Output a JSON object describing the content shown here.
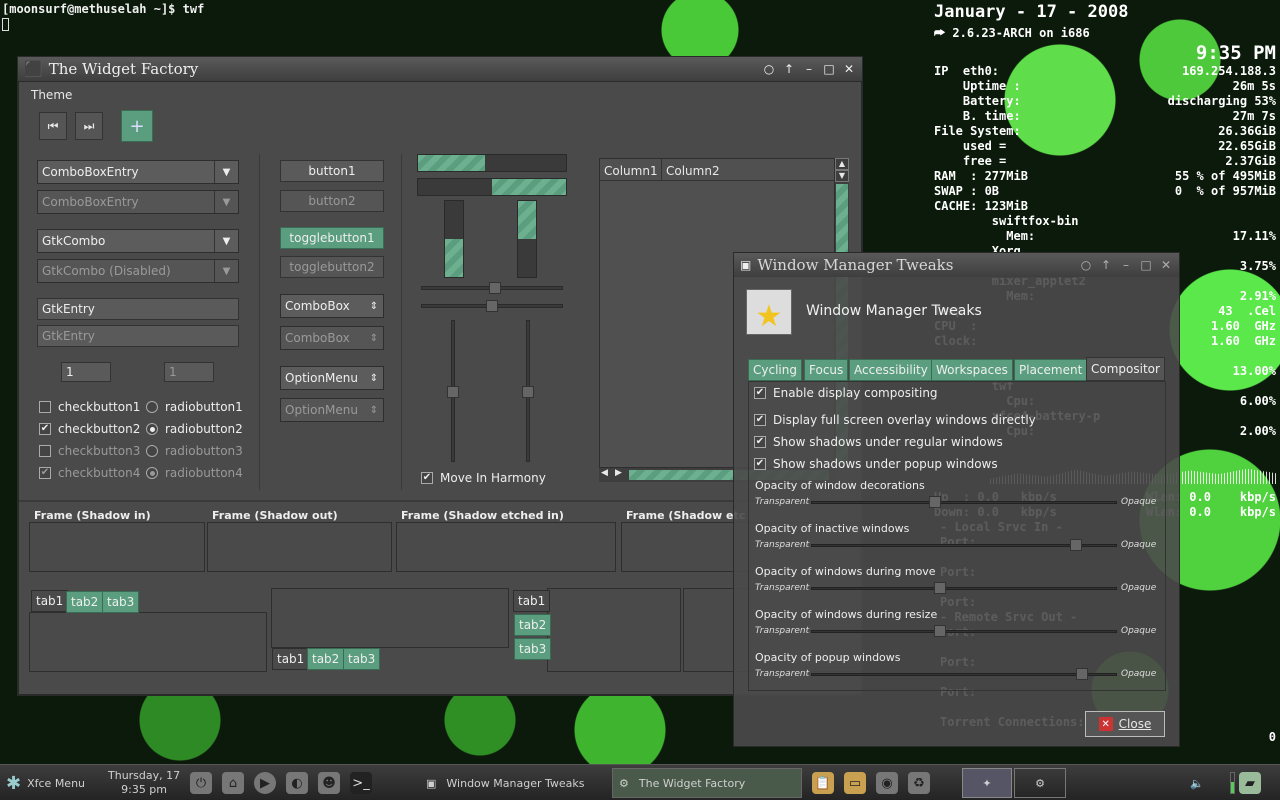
{
  "terminal": {
    "prompt": "[moonsurf@methuselah ~]$ twf"
  },
  "conky": {
    "date": "January - 17 - 2008",
    "kernel": "2.6.23-ARCH on i686",
    "time": "9:35 PM",
    "rows": [
      {
        "l": "IP  eth0:",
        "r": "169.254.188.3"
      },
      {
        "l": "    Uptime :",
        "r": "26m 5s"
      },
      {
        "l": "    Battery:",
        "r": "discharging 53%"
      },
      {
        "l": "    B. time:",
        "r": "27m 7s"
      },
      {
        "l": "File System:",
        "r": "26.36GiB"
      },
      {
        "l": "    used =",
        "r": "22.65GiB"
      },
      {
        "l": "    free =",
        "r": "2.37GiB"
      },
      {
        "l": "RAM  : 277MiB",
        "r": "55 % of 495MiB"
      },
      {
        "l": "SWAP : 0B",
        "r": "0  % of 957MiB"
      },
      {
        "l": "CACHE: 123MiB",
        "r": ""
      },
      {
        "l": "        swiftfox-bin",
        "r": ""
      },
      {
        "l": "          Mem:",
        "r": "17.11%"
      },
      {
        "l": "        Xorg",
        "r": ""
      },
      {
        "l": "          Mem:",
        "r": "3.75%"
      },
      {
        "l": "        mixer_applet2",
        "r": ""
      },
      {
        "l": "          Mem:",
        "r": "2.91%"
      },
      {
        "l": "Temp :",
        "r": "43  .Cel"
      },
      {
        "l": "CPU  :",
        "r": "1.60  GHz"
      },
      {
        "l": "Clock:",
        "r": "1.60  GHz"
      },
      {
        "l": "",
        "r": ""
      },
      {
        "l": "          Cpu:",
        "r": "13.00%"
      },
      {
        "l": "        twf",
        "r": ""
      },
      {
        "l": "          Cpu:",
        "r": "6.00%"
      },
      {
        "l": "        xfce4-battery-p",
        "r": ""
      },
      {
        "l": "          Cpu:",
        "r": "2.00%"
      }
    ],
    "net": [
      {
        "l": "Up  : 0.0   kbp/s",
        "r": "Wlan: 0.0    kbp/s"
      },
      {
        "l": "Down: 0.0   kbp/s",
        "r": "Wlan: 0.0    kbp/s"
      }
    ],
    "services": [
      "- Local Srvc In -",
      "Port:",
      "",
      "Port:",
      "",
      "Port:",
      "- Remote Srvc Out -",
      "Port:",
      "",
      "Port:",
      "",
      "Port:",
      "",
      "Torrent Connections:"
    ],
    "torrent_count": "0"
  },
  "twf": {
    "title": "The Widget Factory",
    "menu": "Theme",
    "combos": [
      "ComboBoxEntry",
      "ComboBoxEntry",
      "GtkCombo",
      "GtkCombo (Disabled)"
    ],
    "entries": [
      "GtkEntry",
      "GtkEntry"
    ],
    "spin": [
      "1",
      "1"
    ],
    "checks": [
      "checkbutton1",
      "checkbutton2",
      "checkbutton3",
      "checkbutton4"
    ],
    "radios": [
      "radiobutton1",
      "radiobutton2",
      "radiobutton3",
      "radiobutton4"
    ],
    "buttons": [
      "button1",
      "button2",
      "togglebutton1",
      "togglebutton2",
      "ComboBox",
      "ComboBox",
      "OptionMenu",
      "OptionMenu"
    ],
    "harmony": "Move In Harmony",
    "progress": {
      "h1": 0.45,
      "h2": 0.5,
      "v1": 0.5,
      "v2": 0.5
    },
    "columns": [
      "Column1",
      "Column2"
    ],
    "frames": [
      "Frame (Shadow in)",
      "Frame (Shadow out)",
      "Frame (Shadow etched in)",
      "Frame (Shadow etc"
    ],
    "tabs": [
      "tab1",
      "tab2",
      "tab3"
    ]
  },
  "wmt": {
    "title": "Window Manager Tweaks",
    "header": "Window Manager Tweaks",
    "tabs": [
      "Cycling",
      "Focus",
      "Accessibility",
      "Workspaces",
      "Placement",
      "Compositor"
    ],
    "checks": [
      "Enable display compositing",
      "Display full screen overlay windows directly",
      "Show shadows under regular windows",
      "Show shadows under popup windows"
    ],
    "opacity": [
      {
        "label": "Opacity of window decorations",
        "value": 0.4
      },
      {
        "label": "Opacity of inactive windows",
        "value": 0.88
      },
      {
        "label": "Opacity of windows during move",
        "value": 0.42
      },
      {
        "label": "Opacity of windows during resize",
        "value": 0.42
      },
      {
        "label": "Opacity of popup windows",
        "value": 0.9
      }
    ],
    "transparent": "Transparent",
    "opaque": "Opaque",
    "close": "Close"
  },
  "taskbar": {
    "menu": "Xfce Menu",
    "clock_date": "Thursday, 17",
    "clock_time": "9:35 pm",
    "tasks": [
      "Window Manager Tweaks",
      "The Widget Factory"
    ]
  }
}
